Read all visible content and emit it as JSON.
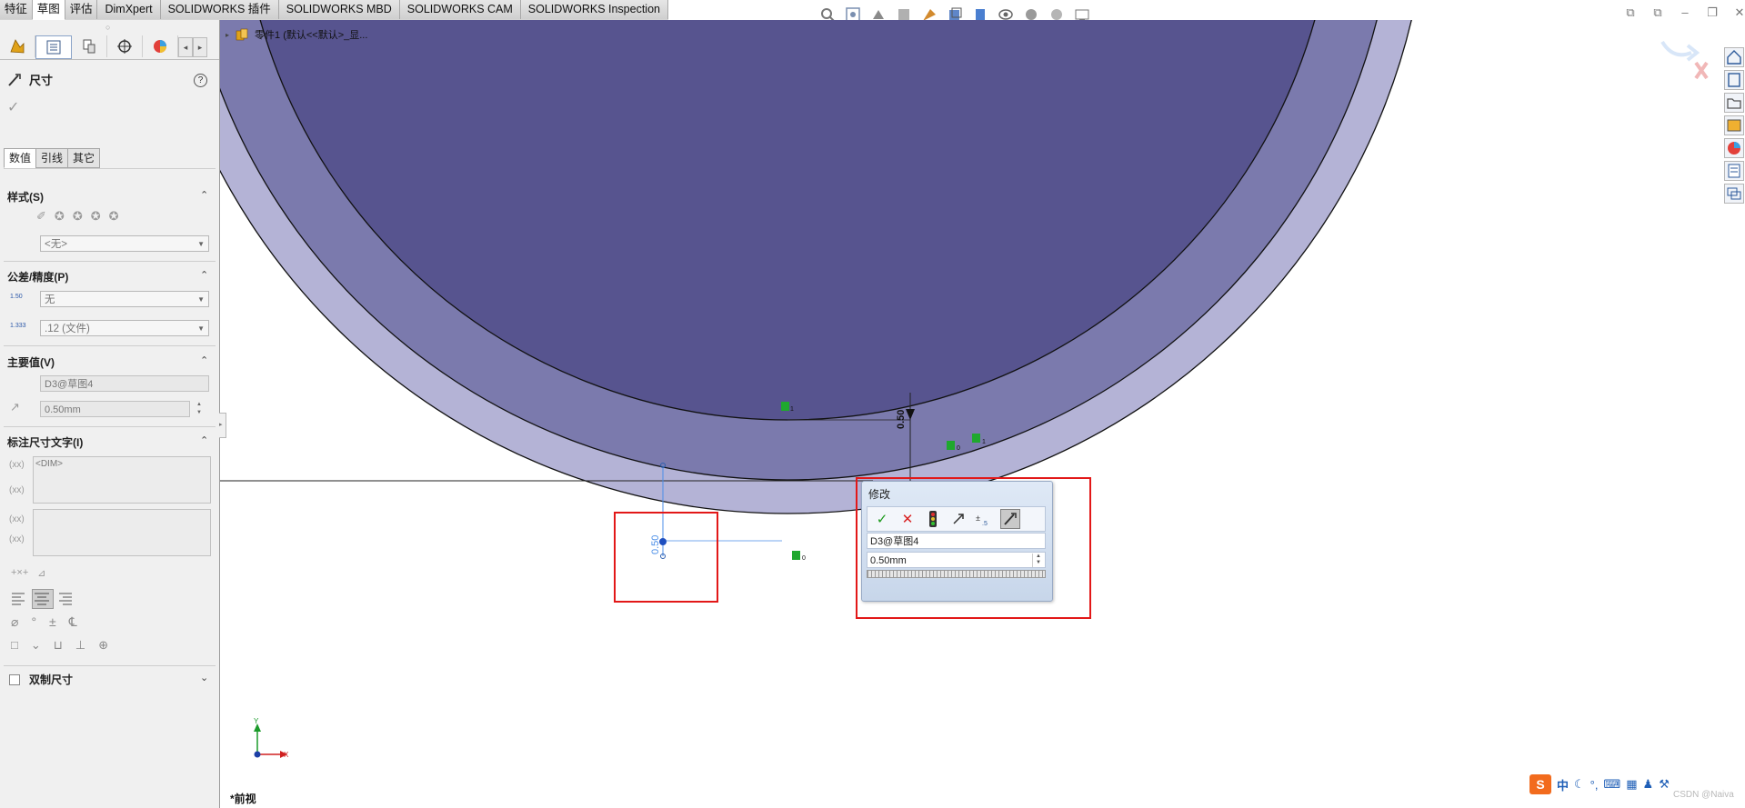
{
  "tabs": [
    "特征",
    "草图",
    "评估",
    "DimXpert",
    "SOLIDWORKS 插件",
    "SOLIDWORKS MBD",
    "SOLIDWORKS CAM",
    "SOLIDWORKS Inspection"
  ],
  "active_tab": "草图",
  "feature_tree": {
    "label": "零件1  (默认<<默认>_显..."
  },
  "property_manager": {
    "title": "尺寸",
    "help": "?",
    "subtabs": [
      "数值",
      "引线",
      "其它"
    ],
    "style_section": {
      "title": "样式(S)",
      "combo": "<无>"
    },
    "tolerance_section": {
      "title": "公差/精度(P)",
      "tolerance_type": "无",
      "precision": ".12 (文件)",
      "tol_icon_text": "1.50",
      "prec_icon_text": "1.333"
    },
    "primary_value_section": {
      "title": "主要值(V)",
      "name": "D3@草图4",
      "value": "0.50mm"
    },
    "dim_text_section": {
      "title": "标注尺寸文字(I)",
      "dim_token": "<DIM>"
    },
    "dual_dimension": {
      "label": "双制尺寸"
    }
  },
  "modify_dialog": {
    "title": "修改",
    "name": "D3@草图4",
    "value": "0.50mm"
  },
  "canvas": {
    "dim_text_top": "0.50",
    "dim_text_left": "0.50",
    "view_label": "*前视",
    "axis_x": "X",
    "axis_y": "Y",
    "relation_labels": [
      "1",
      "0",
      "1",
      "0"
    ]
  },
  "ime": {
    "brand": "S",
    "lang": "中"
  },
  "watermark": "CSDN @Naiva"
}
